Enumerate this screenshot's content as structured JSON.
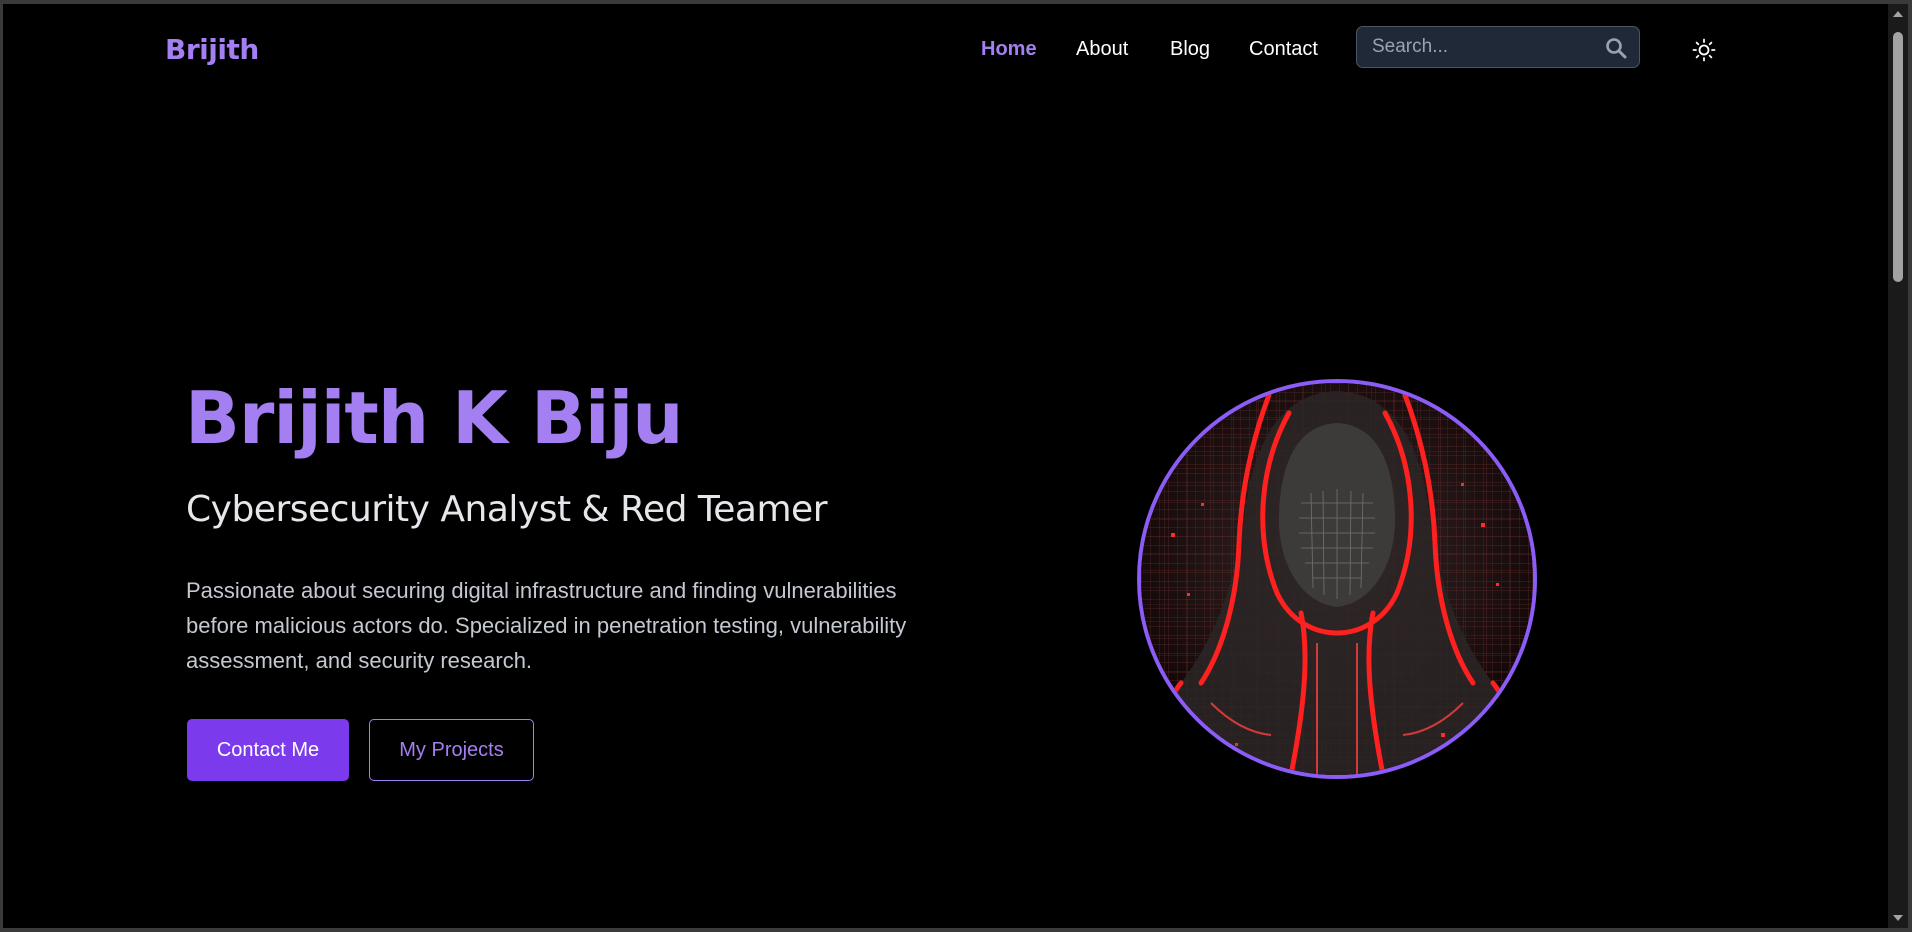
{
  "header": {
    "logo": "Brijith",
    "nav": [
      {
        "label": "Home",
        "active": true
      },
      {
        "label": "About",
        "active": false
      },
      {
        "label": "Blog",
        "active": false
      },
      {
        "label": "Contact",
        "active": false
      }
    ],
    "search": {
      "placeholder": "Search...",
      "icon": "search-icon"
    },
    "theme_toggle_icon": "sun-icon"
  },
  "hero": {
    "name": "Brijith K Biju",
    "role": "Cybersecurity Analyst & Red Teamer",
    "description": "Passionate about securing digital infrastructure and finding vulnerabilities before malicious actors do. Specialized in penetration testing, vulnerability assessment, and security research.",
    "primary_button": "Contact Me",
    "secondary_button": "My Projects",
    "avatar_icon": "hooded-hacker-avatar"
  },
  "colors": {
    "accent": "#a47ff2",
    "button_primary": "#7c3aed",
    "avatar_ring": "#8b5cf6",
    "background": "#000000",
    "search_bg": "#1f2937"
  }
}
